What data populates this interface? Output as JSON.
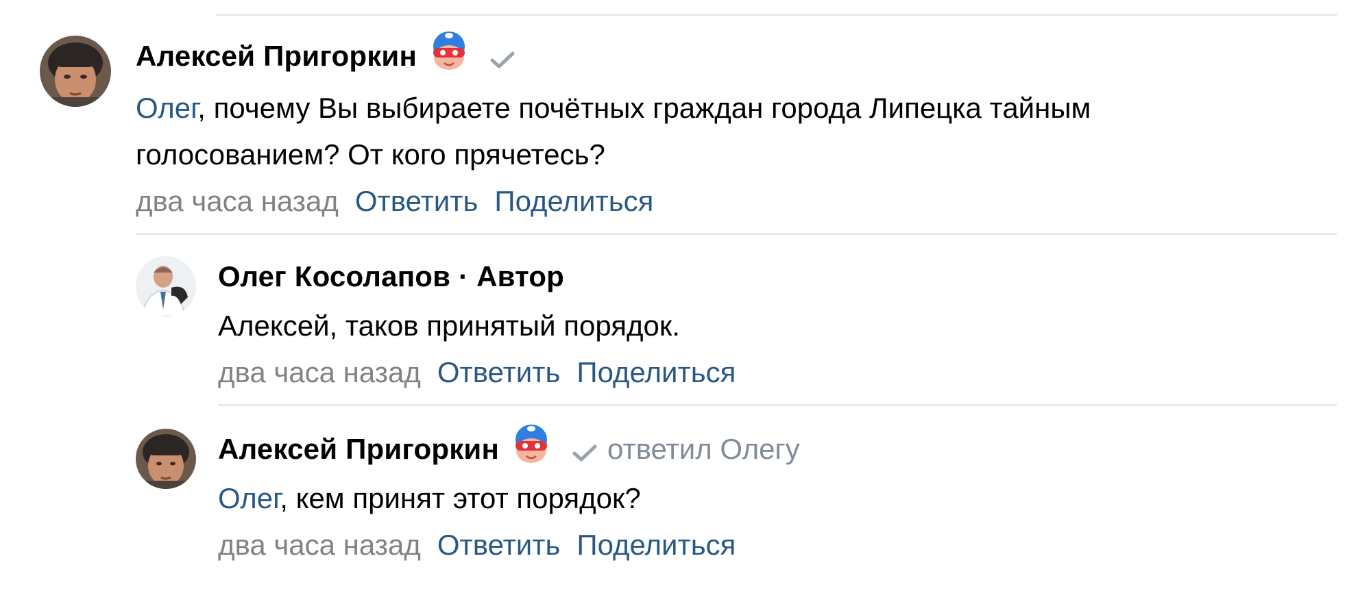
{
  "comments": [
    {
      "author": "Алексей Пригоркин",
      "reply_to": "",
      "mention": "Олег",
      "text_line1": ", почему Вы выбираете почётных граждан города Липецка тайным",
      "text_line2": "голосованием? От кого прячетесь?",
      "time": "два часа назад",
      "reply_label": "Ответить",
      "share_label": "Поделиться"
    },
    {
      "author": "Олег Косолапов · Автор",
      "text": "Алексей, таков принятый порядок.",
      "time": "два часа назад",
      "reply_label": "Ответить",
      "share_label": "Поделиться"
    },
    {
      "author": "Алексей Пригоркин",
      "reply_to": "ответил Олегу",
      "mention": "Олег",
      "text": ", кем принят этот порядок?",
      "time": "два часа назад",
      "reply_label": "Ответить",
      "share_label": "Поделиться"
    }
  ],
  "icons": {
    "badge": "superhero-mask-icon",
    "verified": "checkmark-icon"
  },
  "colors": {
    "link": "#2a5885",
    "meta": "#828282",
    "divider": "#e7e8ec",
    "check": "#99a2ad"
  }
}
